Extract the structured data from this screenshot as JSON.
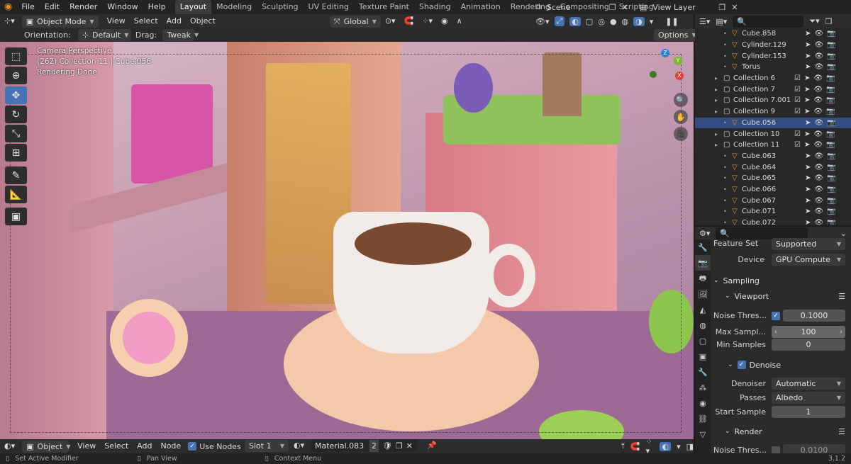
{
  "topbar": {
    "menus": [
      "File",
      "Edit",
      "Render",
      "Window",
      "Help"
    ],
    "workspaces": [
      "Layout",
      "Modeling",
      "Sculpting",
      "UV Editing",
      "Texture Paint",
      "Shading",
      "Animation",
      "Rendering",
      "Compositing",
      "Scripting"
    ],
    "active_workspace": "Layout",
    "scene": "Scene",
    "view_layer": "View Layer"
  },
  "viewport_header": {
    "mode": "Object Mode",
    "menus": [
      "View",
      "Select",
      "Add",
      "Object"
    ],
    "transform_orientation": "Global"
  },
  "tool_header": {
    "orientation_label": "Orientation:",
    "orientation_value": "Default",
    "drag_label": "Drag:",
    "drag_value": "Tweak",
    "options": "Options"
  },
  "viewport": {
    "overlay_line1": "Camera Perspective",
    "overlay_line2": "(262) Collection 11 | Cube.056",
    "overlay_line3": "Rendering Done",
    "gizmo_x": "X",
    "gizmo_y": "Y",
    "gizmo_z": "Z"
  },
  "outliner": {
    "rows": [
      {
        "indent": 3,
        "name": "Cube.858",
        "type": "mesh",
        "selected": false
      },
      {
        "indent": 3,
        "name": "Cylinder.129",
        "type": "mesh",
        "selected": false
      },
      {
        "indent": 3,
        "name": "Cylinder.153",
        "type": "mesh",
        "selected": false
      },
      {
        "indent": 3,
        "name": "Torus",
        "type": "mesh",
        "selected": false
      },
      {
        "indent": 2,
        "name": "Collection 6",
        "type": "collection",
        "selected": false
      },
      {
        "indent": 2,
        "name": "Collection 7",
        "type": "collection",
        "selected": false
      },
      {
        "indent": 2,
        "name": "Collection 7.001",
        "type": "collection",
        "selected": false
      },
      {
        "indent": 2,
        "name": "Collection 9",
        "type": "collection",
        "selected": false
      },
      {
        "indent": 3,
        "name": "Cube.056",
        "type": "mesh",
        "selected": true
      },
      {
        "indent": 2,
        "name": "Collection 10",
        "type": "collection",
        "selected": false
      },
      {
        "indent": 2,
        "name": "Collection 11",
        "type": "collection",
        "selected": false
      },
      {
        "indent": 3,
        "name": "Cube.063",
        "type": "mesh",
        "selected": false
      },
      {
        "indent": 3,
        "name": "Cube.064",
        "type": "mesh",
        "selected": false
      },
      {
        "indent": 3,
        "name": "Cube.065",
        "type": "mesh",
        "selected": false
      },
      {
        "indent": 3,
        "name": "Cube.066",
        "type": "mesh",
        "selected": false
      },
      {
        "indent": 3,
        "name": "Cube.067",
        "type": "mesh",
        "selected": false
      },
      {
        "indent": 3,
        "name": "Cube.071",
        "type": "mesh",
        "selected": false
      },
      {
        "indent": 3,
        "name": "Cube.072",
        "type": "mesh",
        "selected": false
      }
    ]
  },
  "properties": {
    "feature_set_label": "Feature Set",
    "feature_set_value": "Supported",
    "device_label": "Device",
    "device_value": "GPU Compute",
    "sampling": "Sampling",
    "viewport": "Viewport",
    "noise_threshold_label": "Noise Thres...",
    "noise_threshold_value": "0.1000",
    "max_samples_label": "Max Sampl...",
    "max_samples_value": "100",
    "min_samples_label": "Min Samples",
    "min_samples_value": "0",
    "denoise": "Denoise",
    "denoiser_label": "Denoiser",
    "denoiser_value": "Automatic",
    "passes_label": "Passes",
    "passes_value": "Albedo",
    "start_sample_label": "Start Sample",
    "start_sample_value": "1",
    "render": "Render",
    "render_noise_label": "Noise Thres...",
    "render_noise_value": "0.0100"
  },
  "viewport_footer": {
    "mode": "Object",
    "menus": [
      "View",
      "Select",
      "Add",
      "Node"
    ],
    "use_nodes": "Use Nodes",
    "slot": "Slot 1",
    "material": "Material.083",
    "users": "2"
  },
  "statusbar": {
    "left": "Set Active Modifier",
    "middle": "Pan View",
    "right": "Context Menu",
    "version": "3.1.2"
  },
  "colors": {
    "accent": "#4772b3",
    "selection": "#334d80",
    "background": "#1d1d1d"
  }
}
